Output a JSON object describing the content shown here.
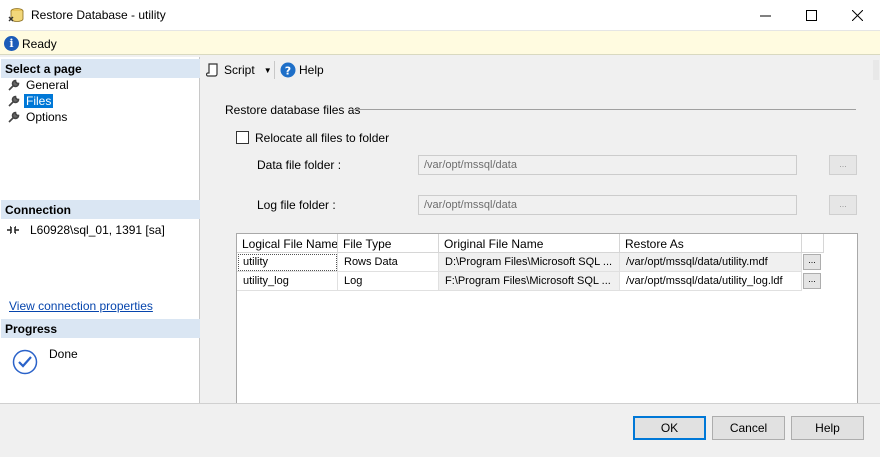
{
  "window": {
    "title": "Restore Database - utility",
    "minimize_glyph": "—",
    "maximize_glyph": "☐",
    "close_glyph": "✕"
  },
  "status": {
    "icon": "info-icon",
    "text": "Ready"
  },
  "left": {
    "select_page_header": "Select a page",
    "pages": [
      {
        "label": "General",
        "selected": false
      },
      {
        "label": "Files",
        "selected": true
      },
      {
        "label": "Options",
        "selected": false
      }
    ],
    "connection_header": "Connection",
    "connection_text": "L60928\\sql_01, 1391 [sa]",
    "view_connection_link": "View connection properties",
    "progress_header": "Progress",
    "progress_text": "Done"
  },
  "toolbar": {
    "script_label": "Script",
    "help_label": "Help"
  },
  "files": {
    "group_title": "Restore database files as",
    "relocate_label": "Relocate all files to folder",
    "relocate_checked": false,
    "data_folder_label": "Data file folder :",
    "data_folder_value": "/var/opt/mssql/data",
    "log_folder_label": "Log file folder :",
    "log_folder_value": "/var/opt/mssql/data",
    "browse_label": "...",
    "grid": {
      "columns": [
        "Logical File Name",
        "File Type",
        "Original File Name",
        "Restore As"
      ],
      "rows": [
        {
          "logical": "utility",
          "type": "Rows Data",
          "original": "D:\\Program Files\\Microsoft SQL ...",
          "restore_as": "/var/opt/mssql/data/utility.mdf",
          "btn": "..."
        },
        {
          "logical": "utility_log",
          "type": "Log",
          "original": "F:\\Program Files\\Microsoft SQL ...",
          "restore_as": "/var/opt/mssql/data/utility_log.ldf",
          "btn": "..."
        }
      ]
    }
  },
  "footer": {
    "ok": "OK",
    "cancel": "Cancel",
    "help": "Help"
  }
}
